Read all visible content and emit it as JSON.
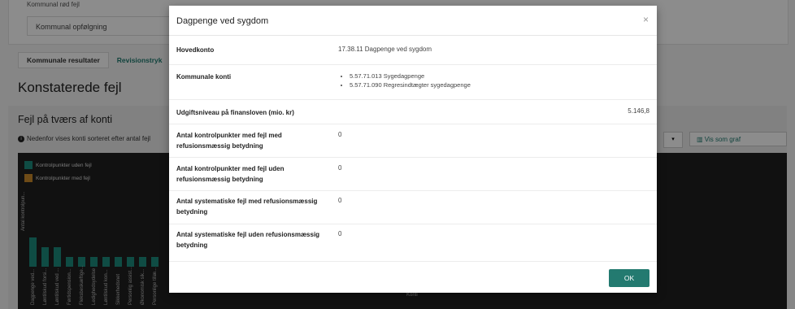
{
  "background": {
    "top_row_partial": "Kommunal rød fejl",
    "field_label": "Kommunal opfølgning",
    "tabs": [
      "Kommunale resultater",
      "Revisionstryk"
    ],
    "section_title": "Konstaterede fejl",
    "subsection_title": "Fejl på tværs af konti",
    "info_text": "Nedenfor vises konti sorteret efter antal fejl",
    "graph_button": "Vis som graf",
    "chart": {
      "legend": [
        {
          "label": "Kontrolpunkter uden fejl",
          "color": "#1d8a7d"
        },
        {
          "label": "Kontrolpunkter med fejl",
          "color": "#c9892a"
        }
      ],
      "y_axis_label": "Antal kontrolpun...",
      "x_axis_label": "Konti",
      "categories": [
        "Dagpenge ved...",
        "Løntilskud forsi...",
        "Løntilskud ved ...",
        "Førtidspension...",
        "Fleksbeskæftige...",
        "Ledighedsydelse",
        "Løntilskud kon...",
        "Sikkerhedsnet",
        "Personlig assist...",
        "Økonomisk sik...",
        "Personlige tillæ..."
      ],
      "values": [
        3,
        2,
        2,
        1,
        1,
        1,
        1,
        1,
        1,
        1,
        1
      ]
    }
  },
  "modal": {
    "title": "Dagpenge ved sygdom",
    "close_icon": "close-icon",
    "rows": {
      "hovedkonto": {
        "label": "Hovedkonto",
        "value": "17.38.11 Dagpenge ved sygdom"
      },
      "kommunale_konti": {
        "label": "Kommunale konti",
        "items": [
          "5.57.71.013 Sygedagpenge",
          "5.57.71.090 Regresindtægter sygedagpenge"
        ]
      },
      "udgiftsniveau": {
        "label": "Udgiftsniveau på finansloven (mio. kr)",
        "value": "5.146,8"
      },
      "kp_med_fejl_med": {
        "label": "Antal kontrolpunkter med fejl med refusionsmæssig betydning",
        "value": "0"
      },
      "kp_med_fejl_uden": {
        "label": "Antal kontrolpunkter med fejl uden refusionsmæssig betydning",
        "value": "0"
      },
      "sys_fejl_med": {
        "label": "Antal systematiske fejl med refusionsmæssig betydning",
        "value": "0"
      },
      "sys_fejl_uden": {
        "label": "Antal systematiske fejl uden refusionsmæssig betydning",
        "value": "0"
      }
    },
    "ok_label": "OK"
  }
}
